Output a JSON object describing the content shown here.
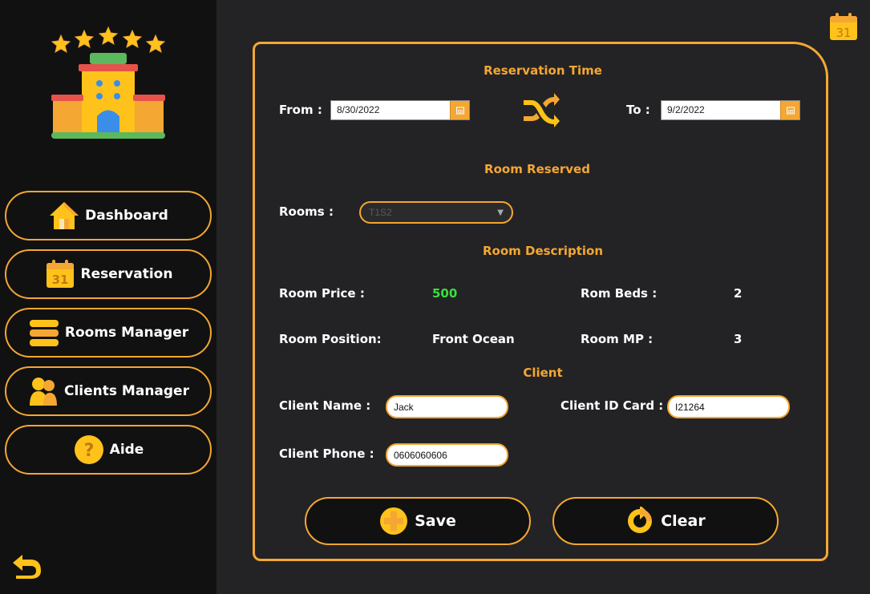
{
  "colors": {
    "accent": "#f4a732",
    "price": "#39e03f",
    "sidebar_bg": "#111111",
    "main_bg": "#232325"
  },
  "sidebar": {
    "items": [
      {
        "label": "Dashboard",
        "icon": "house-icon"
      },
      {
        "label": "Reservation",
        "icon": "calendar-icon"
      },
      {
        "label": "Rooms Manager",
        "icon": "stack-icon"
      },
      {
        "label": "Clients Manager",
        "icon": "users-icon"
      },
      {
        "label": "Aide",
        "icon": "question-icon"
      }
    ]
  },
  "calendar_day": "31",
  "reservation": {
    "title": "Reservation Time",
    "from_label": "From :",
    "from_value": "8/30/2022",
    "to_label": "To :",
    "to_value": "9/2/2022"
  },
  "room_reserved": {
    "title": "Room Reserved",
    "rooms_label": "Rooms :",
    "rooms_value": "T1S2"
  },
  "room_description": {
    "title": "Room Description",
    "price_label": "Room Price :",
    "price_value": "500",
    "beds_label": "Rom Beds :",
    "beds_value": "2",
    "position_label": "Room Position:",
    "position_value": "Front Ocean",
    "mp_label": "Room MP :",
    "mp_value": "3"
  },
  "client": {
    "title": "Client",
    "name_label": "Client Name :",
    "name_value": "Jack",
    "id_label": "Client ID Card :",
    "id_value": "I21264",
    "phone_label": "Client Phone :",
    "phone_value": "0606060606"
  },
  "actions": {
    "save_label": "Save",
    "clear_label": "Clear"
  }
}
